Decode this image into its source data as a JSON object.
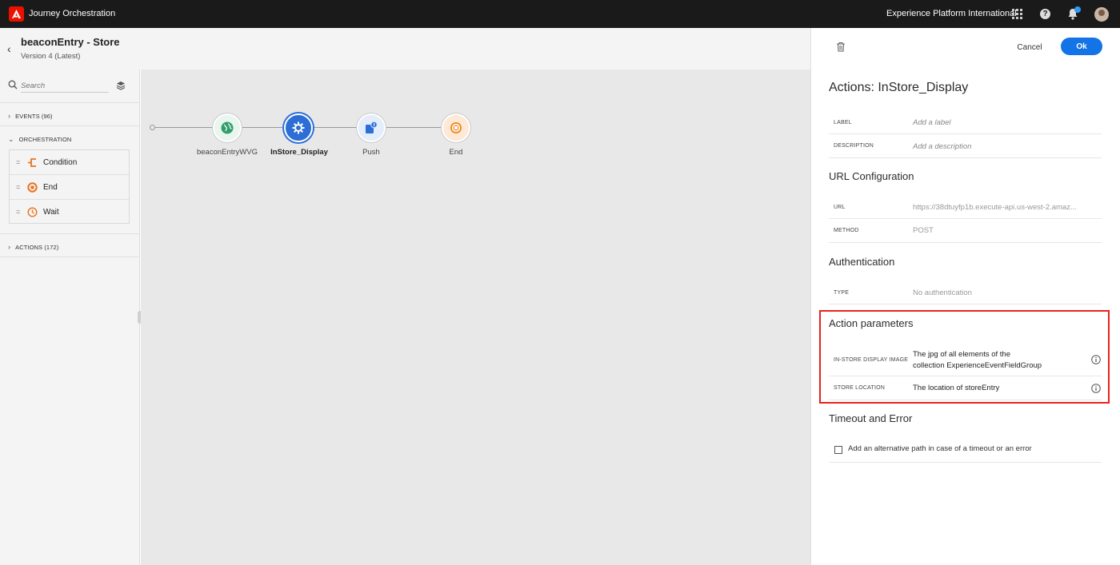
{
  "topbar": {
    "app_title": "Journey Orchestration",
    "org_name": "Experience Platform International",
    "icons": [
      "adobe-logo",
      "apps-grid-icon",
      "help-icon",
      "bell-icon",
      "avatar"
    ],
    "accent": "#eb1000"
  },
  "header": {
    "title": "beaconEntry - Store",
    "version": "Version 4 (Latest)"
  },
  "palette": {
    "search_placeholder": "Search",
    "events_label": "EVENTS (96)",
    "orchestration_label": "ORCHESTRATION",
    "actions_label": "ACTIONS (172)",
    "orchestration_items": [
      {
        "label": "Condition",
        "icon": "condition-icon"
      },
      {
        "label": "End",
        "icon": "end-icon"
      },
      {
        "label": "Wait",
        "icon": "wait-icon"
      }
    ]
  },
  "canvas": {
    "nodes": [
      {
        "label": "beaconEntryWVG",
        "icon": "globe-icon",
        "color": "#2f9e6a"
      },
      {
        "label": "InStore_Display",
        "icon": "custom-action-icon",
        "color": "#2d6ed6",
        "selected": true
      },
      {
        "label": "Push",
        "icon": "push-icon",
        "color": "#2d6ed6"
      },
      {
        "label": "End",
        "icon": "end-icon",
        "color": "#f08a24"
      }
    ]
  },
  "panel": {
    "cancel_label": "Cancel",
    "ok_label": "Ok",
    "title": "Actions: InStore_Display",
    "label_key": "LABEL",
    "label_placeholder": "Add a label",
    "description_key": "DESCRIPTION",
    "description_placeholder": "Add a description",
    "url_config_title": "URL Configuration",
    "url_key": "URL",
    "url_value": "https://38dtuyfp1b.execute-api.us-west-2.amaz...",
    "method_key": "METHOD",
    "method_value": "POST",
    "auth_title": "Authentication",
    "type_key": "TYPE",
    "type_value": "No authentication",
    "params_title": "Action parameters",
    "param1_key": "IN-STORE DISPLAY IMAGE",
    "param1_value_line1": "The jpg of all elements of the",
    "param1_value_line2": "collection ExperienceEventFieldGroup",
    "param2_key": "STORE LOCATION",
    "param2_value": "The location of storeEntry",
    "timeout_title": "Timeout and Error",
    "timeout_checkbox_label": "Add an alternative path in case of a timeout or an error",
    "highlight_color": "#e8221b",
    "primary_button_color": "#1473e6"
  }
}
